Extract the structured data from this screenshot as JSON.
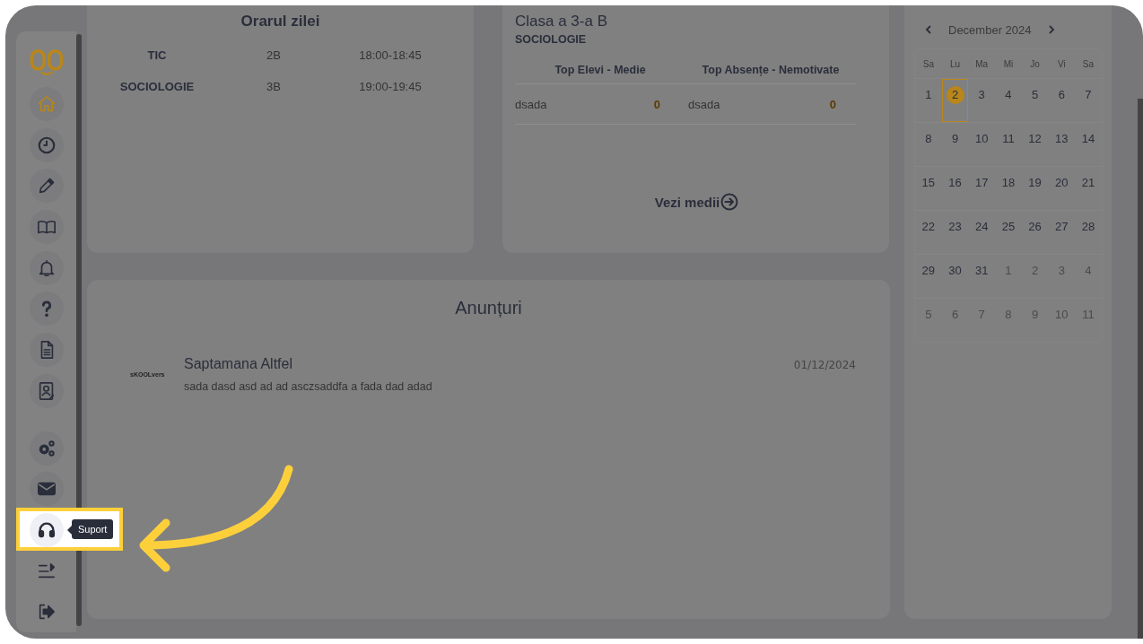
{
  "sidebar": {
    "items": [
      {
        "selected": true
      },
      {
        "selected": false
      },
      {
        "selected": false
      },
      {
        "selected": false
      },
      {
        "selected": false
      },
      {
        "selected": false
      },
      {
        "selected": false
      },
      {
        "selected": false
      },
      {
        "selected": false
      },
      {
        "selected": false
      },
      {
        "selected": false,
        "tooltip": "Suport"
      },
      {
        "selected": false
      },
      {
        "selected": false
      }
    ]
  },
  "schedule": {
    "title": "Orarul zilei",
    "rows": [
      {
        "subject": "TIC",
        "class": "2B",
        "time": "18:00-18:45"
      },
      {
        "subject": "SOCIOLOGIE",
        "class": "3B",
        "time": "19:00-19:45"
      }
    ]
  },
  "class_card": {
    "title": "Clasa a 3-a B",
    "subject": "SOCIOLOGIE",
    "columns": [
      "Top Elevi - Medie",
      "Top Absențe - Nemotivate"
    ],
    "rows": [
      {
        "name": "dsada",
        "value": "0"
      },
      {
        "name": "dsada",
        "value": "0"
      }
    ],
    "link": "Vezi medii"
  },
  "announcements": {
    "title": "Anunțuri",
    "items": [
      {
        "logo": "sKOOLvers",
        "title": "Saptamana Altfel",
        "date": "01/12/2024",
        "text": "sada dasd asd ad ad asczsaddfa a fada dad adad"
      }
    ]
  },
  "calendar": {
    "month": "December 2024",
    "weekdays": [
      "Sa",
      "Lu",
      "Ma",
      "Mi",
      "Jo",
      "Vi",
      "Sa"
    ],
    "weeks": [
      [
        {
          "day": "1",
          "muted": false,
          "selected": false
        },
        {
          "day": "2",
          "muted": false,
          "selected": true
        },
        {
          "day": "3",
          "muted": false,
          "selected": false
        },
        {
          "day": "4",
          "muted": false,
          "selected": false
        },
        {
          "day": "5",
          "muted": false,
          "selected": false
        },
        {
          "day": "6",
          "muted": false,
          "selected": false
        },
        {
          "day": "7",
          "muted": false,
          "selected": false
        }
      ],
      [
        {
          "day": "8",
          "muted": false,
          "selected": false
        },
        {
          "day": "9",
          "muted": false,
          "selected": false
        },
        {
          "day": "10",
          "muted": false,
          "selected": false
        },
        {
          "day": "11",
          "muted": false,
          "selected": false
        },
        {
          "day": "12",
          "muted": false,
          "selected": false
        },
        {
          "day": "13",
          "muted": false,
          "selected": false
        },
        {
          "day": "14",
          "muted": false,
          "selected": false
        }
      ],
      [
        {
          "day": "15",
          "muted": false,
          "selected": false
        },
        {
          "day": "16",
          "muted": false,
          "selected": false
        },
        {
          "day": "17",
          "muted": false,
          "selected": false
        },
        {
          "day": "18",
          "muted": false,
          "selected": false
        },
        {
          "day": "19",
          "muted": false,
          "selected": false
        },
        {
          "day": "20",
          "muted": false,
          "selected": false
        },
        {
          "day": "21",
          "muted": false,
          "selected": false
        }
      ],
      [
        {
          "day": "22",
          "muted": false,
          "selected": false
        },
        {
          "day": "23",
          "muted": false,
          "selected": false
        },
        {
          "day": "24",
          "muted": false,
          "selected": false
        },
        {
          "day": "25",
          "muted": false,
          "selected": false
        },
        {
          "day": "26",
          "muted": false,
          "selected": false
        },
        {
          "day": "27",
          "muted": false,
          "selected": false
        },
        {
          "day": "28",
          "muted": false,
          "selected": false
        }
      ],
      [
        {
          "day": "29",
          "muted": false,
          "selected": false
        },
        {
          "day": "30",
          "muted": false,
          "selected": false
        },
        {
          "day": "31",
          "muted": false,
          "selected": false
        },
        {
          "day": "1",
          "muted": true,
          "selected": false
        },
        {
          "day": "2",
          "muted": true,
          "selected": false
        },
        {
          "day": "3",
          "muted": true,
          "selected": false
        },
        {
          "day": "4",
          "muted": true,
          "selected": false
        }
      ],
      [
        {
          "day": "5",
          "muted": true,
          "selected": false
        },
        {
          "day": "6",
          "muted": true,
          "selected": false
        },
        {
          "day": "7",
          "muted": true,
          "selected": false
        },
        {
          "day": "8",
          "muted": true,
          "selected": false
        },
        {
          "day": "9",
          "muted": true,
          "selected": false
        },
        {
          "day": "10",
          "muted": true,
          "selected": false
        },
        {
          "day": "11",
          "muted": true,
          "selected": false
        }
      ]
    ]
  }
}
